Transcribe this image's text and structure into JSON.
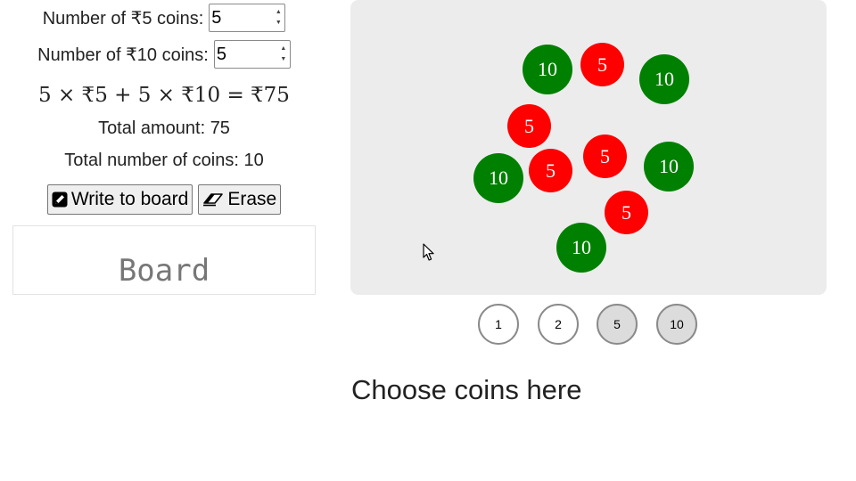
{
  "controls": {
    "five_label": "Number of ₹5 coins:",
    "five_value": "5",
    "ten_label": "Number of ₹10 coins:",
    "ten_value": "5",
    "equation": "5 × ₹5 + 5 × ₹10 = ₹75",
    "total_amount": "Total amount: 75",
    "total_coins": "Total number of coins: 10",
    "write_button": "Write to board",
    "erase_button": "Erase",
    "write_icon": "pencil-icon",
    "erase_icon": "eraser-icon"
  },
  "board": {
    "label": "Board"
  },
  "tray": {
    "coins": [
      {
        "value": "10",
        "color": "#008000"
      },
      {
        "value": "5",
        "color": "#ff0000"
      },
      {
        "value": "10",
        "color": "#008000"
      },
      {
        "value": "5",
        "color": "#ff0000"
      },
      {
        "value": "5",
        "color": "#ff0000"
      },
      {
        "value": "10",
        "color": "#008000"
      },
      {
        "value": "5",
        "color": "#ff0000"
      },
      {
        "value": "10",
        "color": "#008000"
      },
      {
        "value": "5",
        "color": "#ff0000"
      },
      {
        "value": "10",
        "color": "#008000"
      }
    ]
  },
  "picker": {
    "options": [
      "1",
      "2",
      "5",
      "10"
    ],
    "active": [
      "5",
      "10"
    ]
  },
  "footer": {
    "choose_label": "Choose coins here"
  },
  "colors": {
    "coin_5": "#ff0000",
    "coin_10": "#008000",
    "tray_background": "#ececec"
  }
}
